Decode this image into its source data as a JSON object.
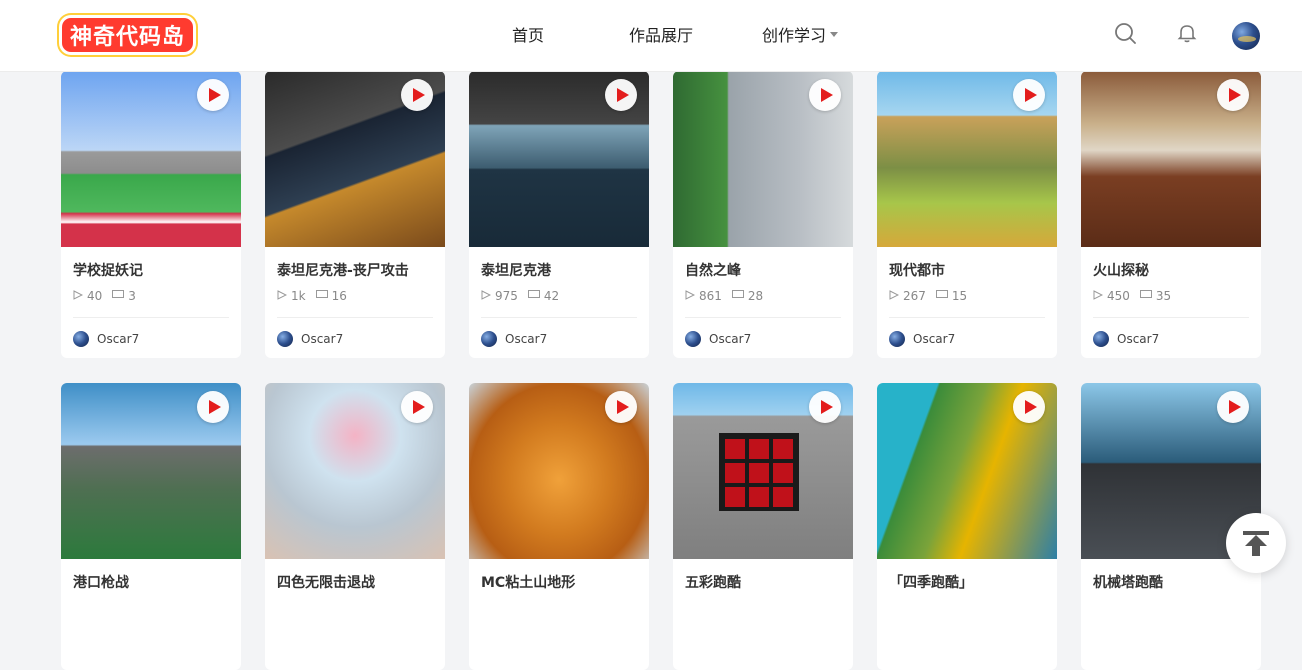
{
  "header": {
    "logo_text": "神奇代码岛",
    "nav": [
      {
        "label": "首页"
      },
      {
        "label": "作品展厅"
      },
      {
        "label": "创作学习"
      }
    ],
    "icons": [
      "search-icon",
      "bell-icon",
      "avatar"
    ]
  },
  "cards": [
    {
      "title": "学校捉妖记",
      "plays": "40",
      "comments": "3",
      "author": "Oscar7"
    },
    {
      "title": "泰坦尼克港-丧尸攻击",
      "plays": "1k",
      "comments": "16",
      "author": "Oscar7"
    },
    {
      "title": "泰坦尼克港",
      "plays": "975",
      "comments": "42",
      "author": "Oscar7"
    },
    {
      "title": "自然之峰",
      "plays": "861",
      "comments": "28",
      "author": "Oscar7"
    },
    {
      "title": "现代都市",
      "plays": "267",
      "comments": "15",
      "author": "Oscar7"
    },
    {
      "title": "火山探秘",
      "plays": "450",
      "comments": "35",
      "author": "Oscar7"
    },
    {
      "title": "港口枪战"
    },
    {
      "title": "四色无限击退战"
    },
    {
      "title": "MC粘土山地形"
    },
    {
      "title": "五彩跑酷"
    },
    {
      "title": "「四季跑酷」"
    },
    {
      "title": "机械塔跑酷"
    }
  ],
  "colors": {
    "accent": "#e31d1d",
    "logo": "#ff3b2f",
    "background": "#f3f4f6"
  },
  "back_to_top_icon": "arrow-up-to-line-icon"
}
